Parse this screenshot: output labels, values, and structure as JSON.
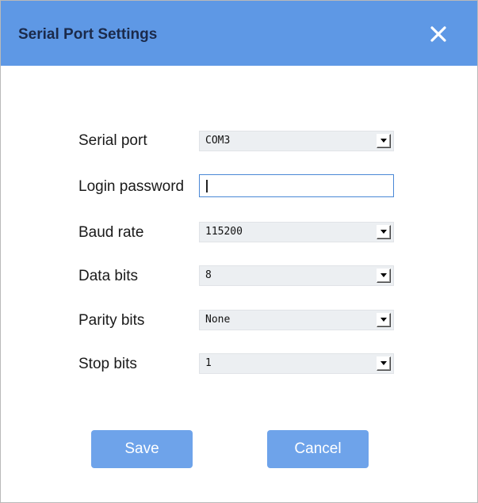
{
  "dialog": {
    "title": "Serial Port Settings",
    "accent_color": "#5e98e5",
    "close_icon": "close-icon"
  },
  "form": {
    "serial_port": {
      "label": "Serial port",
      "value": "COM3"
    },
    "login_password": {
      "label": "Login password",
      "value": ""
    },
    "baud_rate": {
      "label": "Baud rate",
      "value": "115200"
    },
    "data_bits": {
      "label": "Data bits",
      "value": "8"
    },
    "parity_bits": {
      "label": "Parity bits",
      "value": "None"
    },
    "stop_bits": {
      "label": "Stop bits",
      "value": "1"
    }
  },
  "buttons": {
    "save": "Save",
    "cancel": "Cancel",
    "color": "#6ea3ea"
  }
}
